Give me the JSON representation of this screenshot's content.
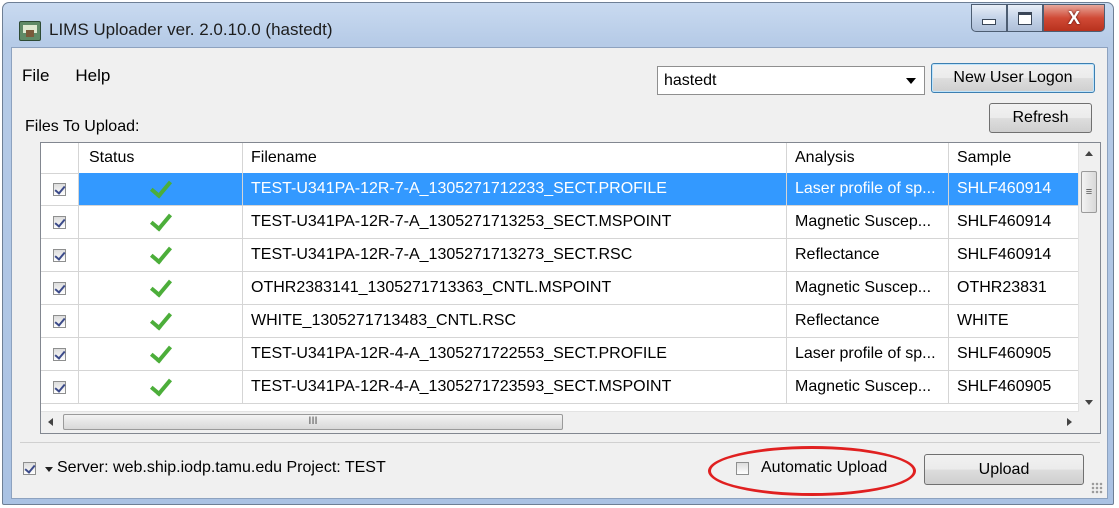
{
  "window": {
    "title": "LIMS Uploader ver. 2.0.10.0  (hastedt)",
    "close_glyph": "X"
  },
  "menu": [
    "File",
    "Help"
  ],
  "user_select": {
    "value": "hastedt"
  },
  "buttons": {
    "new_user_logon": "New User Logon",
    "refresh": "Refresh",
    "upload": "Upload"
  },
  "files_label": "Files To Upload:",
  "table": {
    "columns": [
      "",
      "Status",
      "Filename",
      "Analysis",
      "Sample"
    ],
    "rows": [
      {
        "checked": true,
        "status": "ok",
        "filename": "TEST-U341PA-12R-7-A_1305271712233_SECT.PROFILE",
        "analysis": "Laser profile of sp...",
        "sample": "SHLF460914",
        "selected": true
      },
      {
        "checked": true,
        "status": "ok",
        "filename": "TEST-U341PA-12R-7-A_1305271713253_SECT.MSPOINT",
        "analysis": "Magnetic Suscep...",
        "sample": "SHLF460914",
        "selected": false
      },
      {
        "checked": true,
        "status": "ok",
        "filename": "TEST-U341PA-12R-7-A_1305271713273_SECT.RSC",
        "analysis": "Reflectance",
        "sample": "SHLF460914",
        "selected": false
      },
      {
        "checked": true,
        "status": "ok",
        "filename": "OTHR2383141_1305271713363_CNTL.MSPOINT",
        "analysis": "Magnetic Suscep...",
        "sample": "OTHR23831",
        "selected": false
      },
      {
        "checked": true,
        "status": "ok",
        "filename": "WHITE_1305271713483_CNTL.RSC",
        "analysis": "Reflectance",
        "sample": "WHITE",
        "selected": false
      },
      {
        "checked": true,
        "status": "ok",
        "filename": "TEST-U341PA-12R-4-A_1305271722553_SECT.PROFILE",
        "analysis": "Laser profile of sp...",
        "sample": "SHLF460905",
        "selected": false
      },
      {
        "checked": true,
        "status": "ok",
        "filename": "TEST-U341PA-12R-4-A_1305271723593_SECT.MSPOINT",
        "analysis": "Magnetic Suscep...",
        "sample": "SHLF460905",
        "selected": false
      }
    ]
  },
  "scroll": {
    "thumb_glyph_h": "III",
    "thumb_glyph_v": "≡"
  },
  "status_bar": {
    "server_text": "Server: web.ship.iodp.tamu.edu  Project: TEST",
    "server_checked": true,
    "auto_upload_label": "Automatic Upload",
    "auto_upload_checked": false
  },
  "colors": {
    "selection": "#3399ff",
    "check_green": "#4cae3a",
    "highlight": "#e02020"
  }
}
